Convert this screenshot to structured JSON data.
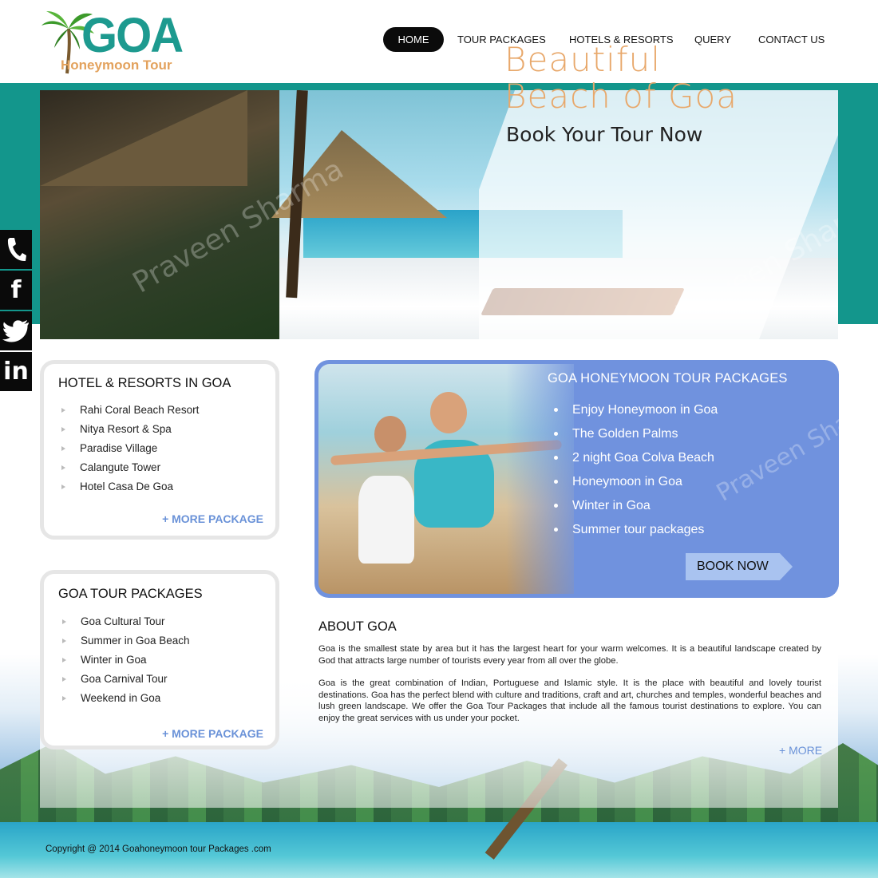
{
  "brand": {
    "name": "GOA",
    "tagline": "Honeymoon Tour"
  },
  "nav": {
    "items": [
      {
        "label": "HOME",
        "active": true
      },
      {
        "label": "TOUR PACKAGES",
        "active": false
      },
      {
        "label": "HOTELS & RESORTS",
        "active": false
      },
      {
        "label": "QUERY",
        "active": false
      },
      {
        "label": "CONTACT US",
        "active": false
      }
    ]
  },
  "hero": {
    "title": "Beautiful Beach of Goa",
    "cta": "Book Your Tour Now",
    "watermark": "Praveen Sharma"
  },
  "social": {
    "items": [
      "phone-icon",
      "facebook-icon",
      "twitter-icon",
      "linkedin-icon"
    ]
  },
  "hotels": {
    "title": "HOTEL & RESORTS IN GOA",
    "items": [
      "Rahi Coral Beach Resort",
      "Nitya Resort & Spa",
      "Paradise Village",
      "Calangute Tower",
      "Hotel Casa De Goa"
    ],
    "more": "+ MORE PACKAGE"
  },
  "tours": {
    "title": "GOA TOUR PACKAGES",
    "items": [
      "Goa Cultural Tour",
      "Summer in Goa Beach",
      "Winter in Goa",
      "Goa Carnival Tour",
      "Weekend in Goa"
    ],
    "more": "+ MORE PACKAGE"
  },
  "packages": {
    "title": "GOA HONEYMOON TOUR PACKAGES",
    "items": [
      "Enjoy Honeymoon in Goa",
      "The Golden Palms",
      "2 night Goa Colva Beach",
      "Honeymoon in Goa",
      "Winter in Goa",
      "Summer tour packages"
    ],
    "book": "BOOK NOW"
  },
  "about": {
    "title": "ABOUT GOA",
    "p1": "Goa is the smallest state by area but it has the largest heart for your warm welcomes. It is a beautiful landscape created by God that attracts large number of tourists every year from all over the globe.",
    "p2": "Goa is the great combination of Indian, Portuguese and Islamic style. It is the place with beautiful and lovely tourist destinations. Goa has the perfect blend with culture and traditions, craft and art, churches and temples, wonderful beaches and lush green landscape. We offer the Goa Tour Packages that include all the famous tourist destinations to explore. You can enjoy the great services with us under your pocket.",
    "more": "+ MORE"
  },
  "footer": {
    "copyright": "Copyright @ 2014 Goahoneymoon tour Packages .com"
  },
  "colors": {
    "teal": "#13968c",
    "accent_blue": "#7092de",
    "link_blue": "#6a92d8",
    "logo_orange": "#e3a25d",
    "hero_title": "#e8a86b"
  }
}
